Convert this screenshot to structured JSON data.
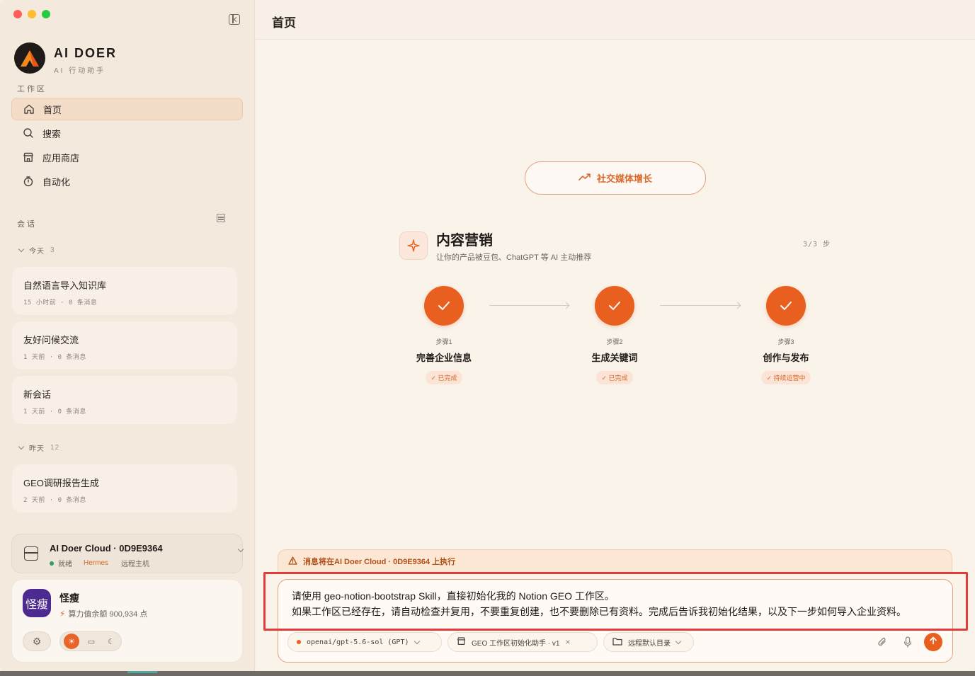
{
  "sidebar": {
    "app_name": "AI DOER",
    "app_subtitle": "AI 行动助手",
    "workspace_label": "工作区",
    "nav": [
      {
        "label": "首页",
        "icon": "home-icon",
        "active": true
      },
      {
        "label": "搜索",
        "icon": "search-icon"
      },
      {
        "label": "应用商店",
        "icon": "store-icon"
      },
      {
        "label": "自动化",
        "icon": "timer-icon"
      }
    ],
    "sessions_label": "会话",
    "groups": [
      {
        "label": "今天",
        "count": "3"
      },
      {
        "label": "昨天",
        "count": "12"
      }
    ],
    "conversations": [
      {
        "title": "自然语言导入知识库",
        "meta": "15 小时前 · 0 条消息"
      },
      {
        "title": "友好问候交流",
        "meta": "1 天前 · 0 条消息"
      },
      {
        "title": "新会话",
        "meta": "1 天前 · 0 条消息"
      },
      {
        "title": "GEO调研报告生成",
        "meta": "2 天前 · 0 条消息"
      }
    ],
    "host": {
      "name": "AI Doer Cloud · 0D9E9364",
      "status": "就绪",
      "runtime": "Hermes",
      "type": "远程主机"
    },
    "user": {
      "avatar_text": "怪瘦",
      "name": "怪瘦",
      "credit": "算力值余额 900,934 点"
    }
  },
  "main": {
    "title": "首页",
    "pill_label": "社交媒体增长",
    "marketing": {
      "title": "内容营销",
      "subtitle": "让你的产品被豆包、ChatGPT 等 AI 主动推荐",
      "progress": "3/3 步"
    },
    "steps": [
      {
        "num": "步骤1",
        "name": "完善企业信息",
        "badge": "已完成"
      },
      {
        "num": "步骤2",
        "name": "生成关键词",
        "badge": "已完成"
      },
      {
        "num": "步骤3",
        "name": "创作与发布",
        "badge": "持续运营中"
      }
    ],
    "notice": "消息将在AI Doer Cloud · 0D9E9364 上执行",
    "prompt_line1": "请使用 geo-notion-bootstrap Skill，直接初始化我的 Notion GEO 工作区。",
    "prompt_line2": "如果工作区已经存在，请自动检查并复用，不要重复创建，也不要删除已有资料。完成后告诉我初始化结果，以及下一步如何导入企业资料。",
    "model_chip": "openai/gpt-5.6-sol (GPT)",
    "skill_chip": "GEO 工作区初始化助手 · v1",
    "dir_chip": "远程默认目录"
  },
  "colors": {
    "accent": "#e95f1f",
    "sidebar_bg": "#f3e9dd",
    "main_bg": "#faf3ea",
    "highlight_frame": "#e03c3c"
  }
}
